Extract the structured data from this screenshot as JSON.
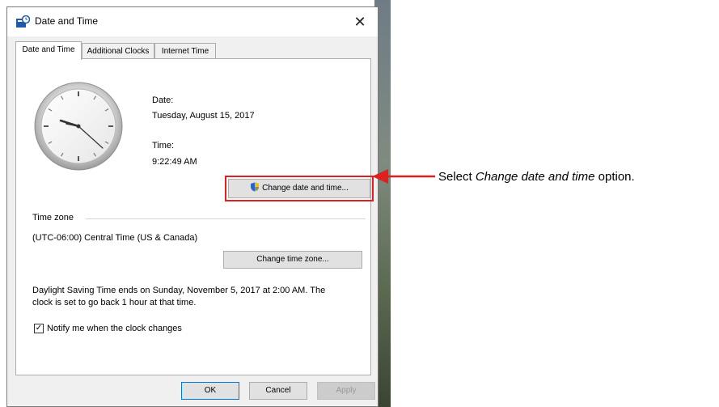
{
  "window": {
    "title": "Date and Time",
    "close_glyph": "✕"
  },
  "tabs": [
    {
      "label": "Date and Time",
      "active": true
    },
    {
      "label": "Additional Clocks",
      "active": false
    },
    {
      "label": "Internet Time",
      "active": false
    }
  ],
  "datetime": {
    "date_label": "Date:",
    "date_value": "Tuesday, August 15, 2017",
    "time_label": "Time:",
    "time_value": "9:22:49 AM",
    "change_button": "Change date and time..."
  },
  "timezone": {
    "section_label": "Time zone",
    "value": "(UTC-06:00) Central Time (US & Canada)",
    "change_button": "Change time zone..."
  },
  "dst": {
    "line1": "Daylight Saving Time ends on Sunday, November 5, 2017 at 2:00 AM. The",
    "line2": "clock is set to go back 1 hour at that time."
  },
  "notify": {
    "label": "Notify me when the clock changes",
    "checked": true,
    "check_glyph": "✓"
  },
  "footer": {
    "ok": "OK",
    "cancel": "Cancel",
    "apply": "Apply"
  },
  "annotation": {
    "prefix": "Select ",
    "emphasis": "Change date and time",
    "suffix": " option."
  },
  "icons": {
    "app": "date-time-app-icon",
    "close": "close-icon",
    "shield": "uac-shield-icon",
    "clock": "analog-clock-icon",
    "arrow": "red-arrow-pointer"
  },
  "colors": {
    "highlight": "#e02020",
    "arrow": "#e02020",
    "ok_border": "#0078d7"
  }
}
